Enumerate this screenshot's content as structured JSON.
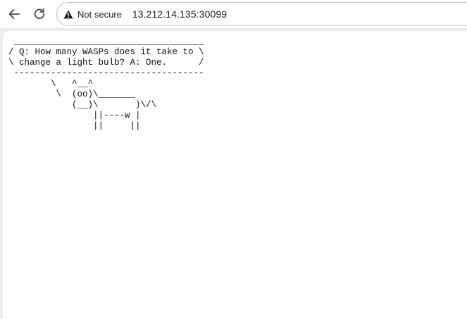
{
  "browser": {
    "security_label": "Not secure",
    "url": "13.212.14.135:30099",
    "icons": {
      "back": "back-arrow-icon",
      "reload": "reload-icon",
      "security": "warning-triangle-icon"
    }
  },
  "page": {
    "cowsay_output": " ____________________________________\n/ Q: How many WASPs does it take to \\\n\\ change a light bulb? A: One.      /\n ------------------------------------\n        \\   ^__^\n         \\  (oo)\\_______\n            (__)\\       )\\/\\\n                ||----w |\n                ||     ||"
  }
}
